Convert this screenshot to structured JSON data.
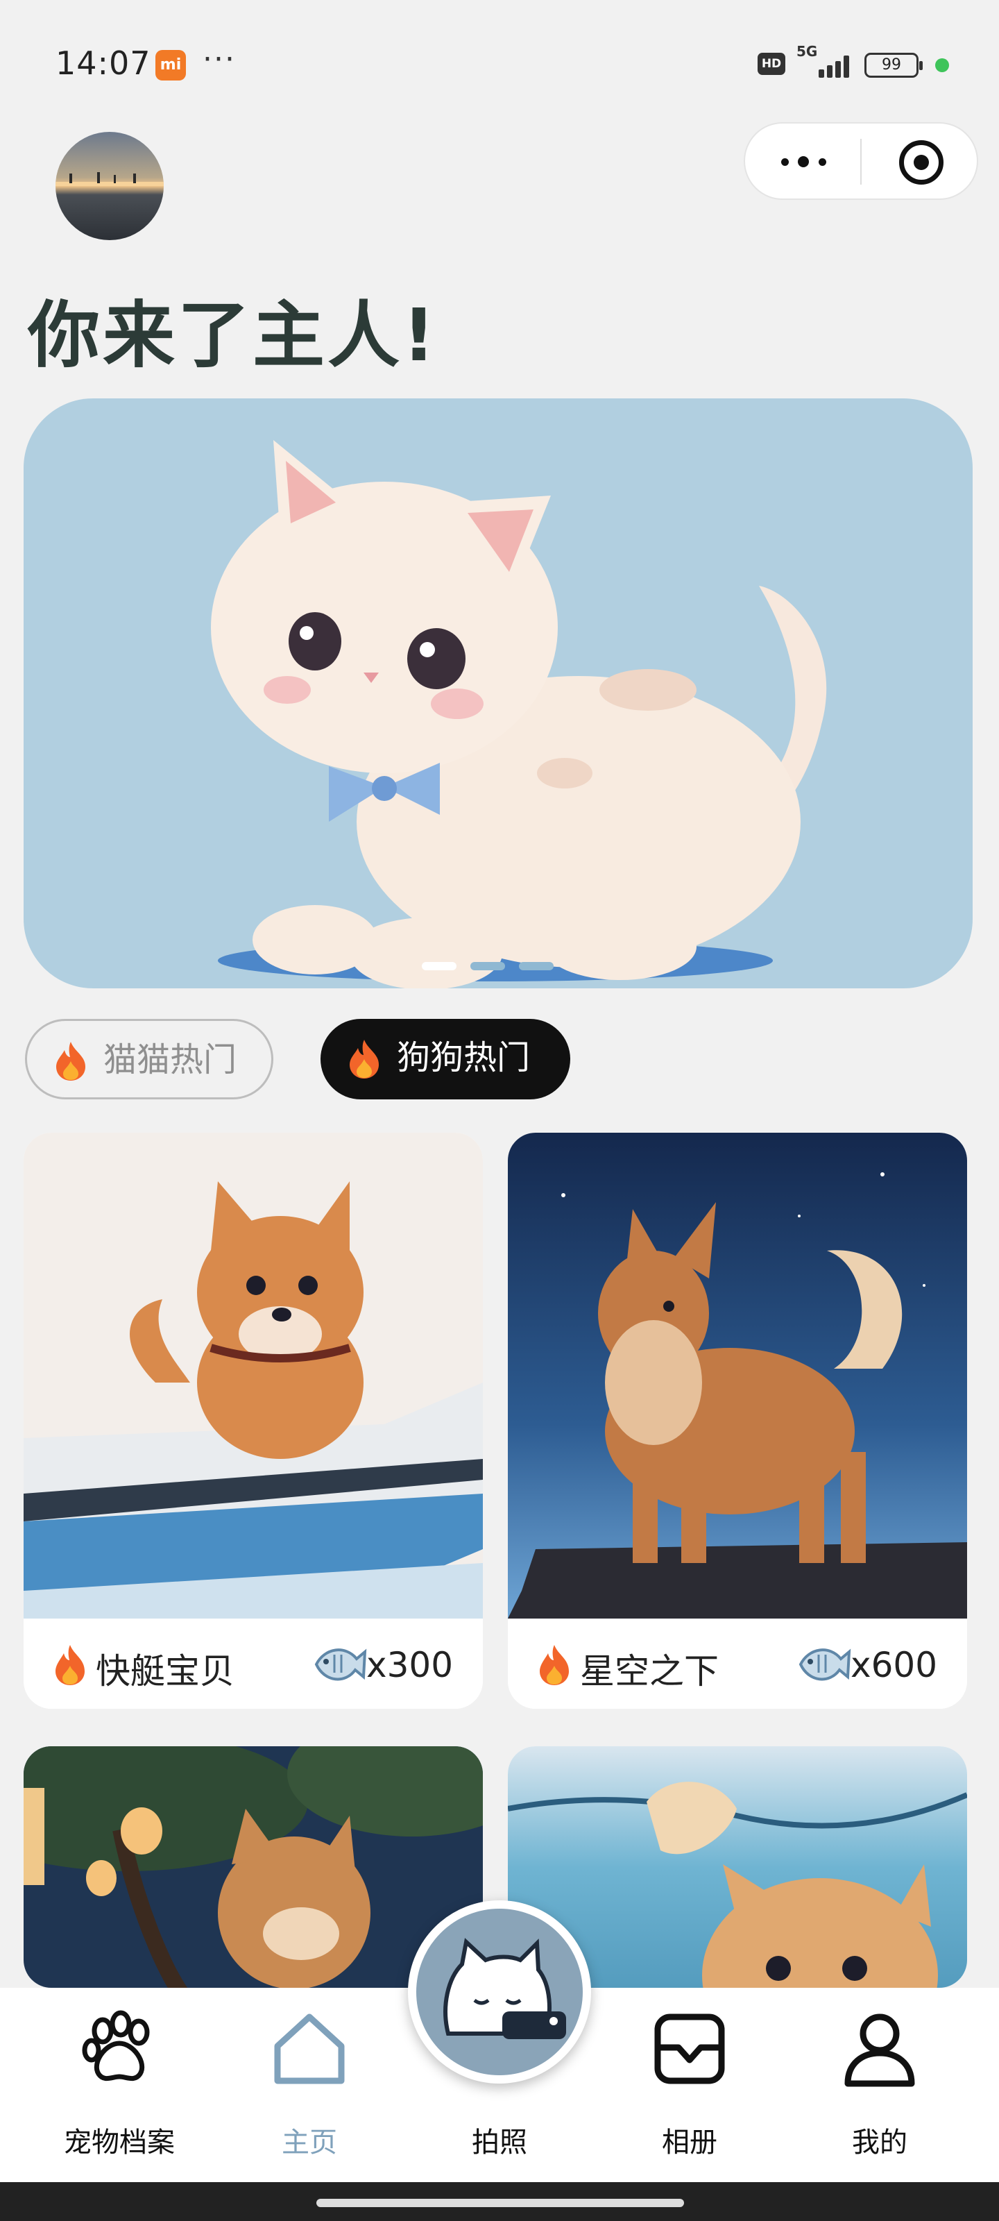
{
  "status_bar": {
    "time": "14:07",
    "mi_badge": "mi",
    "dots": "···",
    "hd": "HD",
    "network": "5G",
    "battery": "99"
  },
  "header": {
    "greeting": "你来了主人!"
  },
  "tabs": [
    {
      "label": "猫猫热门",
      "active": false
    },
    {
      "label": "狗狗热门",
      "active": true
    }
  ],
  "cards": [
    {
      "title": "快艇宝贝",
      "price": "x300"
    },
    {
      "title": "星空之下",
      "price": "x600"
    },
    {
      "title": "",
      "price": ""
    },
    {
      "title": "",
      "price": ""
    }
  ],
  "bottom_nav": [
    {
      "label": "宠物档案",
      "icon": "paw-icon"
    },
    {
      "label": "主页",
      "icon": "home-icon",
      "active": true
    },
    {
      "label": "拍照",
      "icon": "camera-cat-icon"
    },
    {
      "label": "相册",
      "icon": "album-icon"
    },
    {
      "label": "我的",
      "icon": "profile-icon"
    }
  ],
  "colors": {
    "accent": "#7fa1bb",
    "greeting": "#2c3b37",
    "banner_bg": "#b1cfe0",
    "camera_button": "#8aa4b8"
  }
}
